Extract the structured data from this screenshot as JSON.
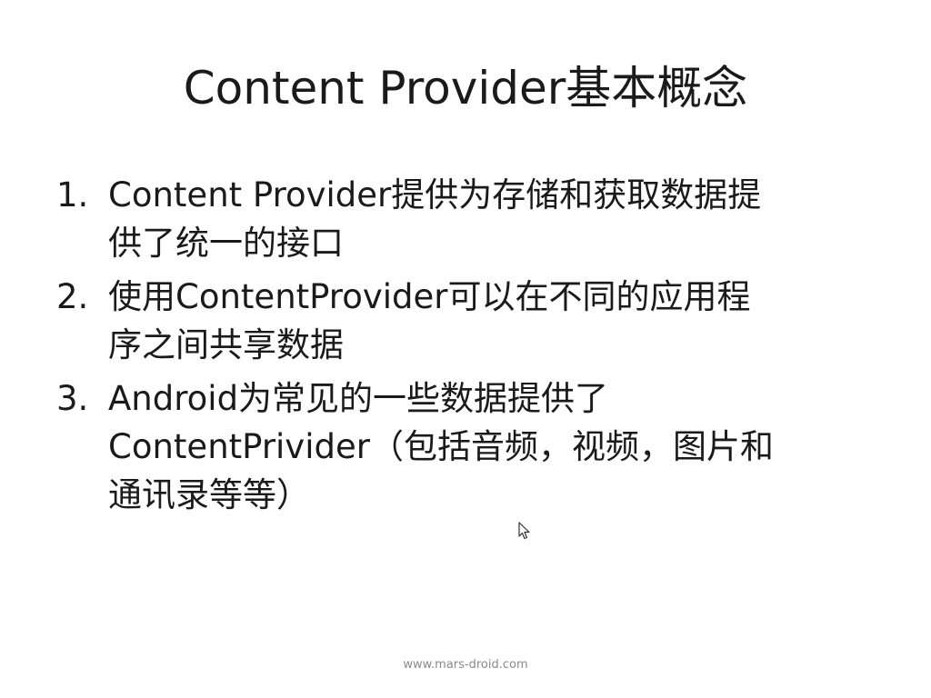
{
  "slide": {
    "title": "Content Provider基本概念",
    "items": [
      {
        "number": "1.",
        "lines": [
          "Content Provider提供为存储和获取数据提",
          "供了统一的接口"
        ]
      },
      {
        "number": "2.",
        "lines": [
          "使用ContentProvider可以在不同的应用程",
          "序之间共享数据"
        ]
      },
      {
        "number": "3.",
        "lines": [
          "Android为常见的一些数据提供了",
          "ContentPrivider（包括音频，视频，图片和",
          "通讯录等等）"
        ]
      }
    ],
    "footer": "www.mars-droid.com"
  },
  "icons": {
    "cursor": "mouse-pointer-icon"
  }
}
